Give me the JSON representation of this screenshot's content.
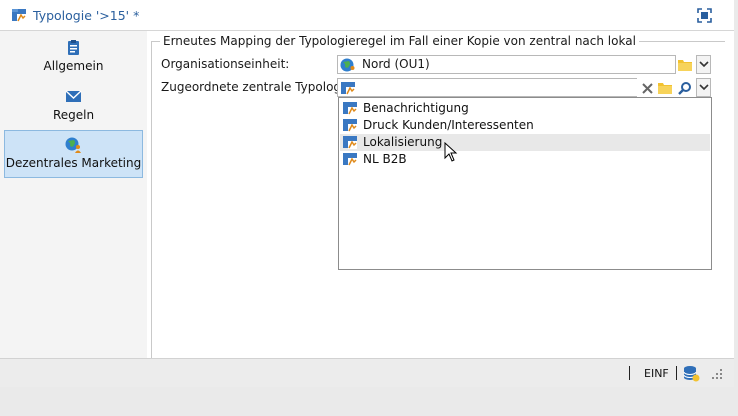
{
  "window": {
    "title": "Typologie '>15' *"
  },
  "sidebar": {
    "items": [
      {
        "label": "Allgemein",
        "icon": "clipboard-icon"
      },
      {
        "label": "Regeln",
        "icon": "envelope-icon"
      },
      {
        "label": "Dezentrales Marketing",
        "icon": "globe-person-icon",
        "active": true
      }
    ]
  },
  "form": {
    "group_title": "Erneutes Mapping der Typologieregel im Fall einer Kopie von zentral nach lokal",
    "org_label": "Organisationseinheit:",
    "org_value": "Nord (OU1)",
    "typology_label": "Zugeordnete zentrale Typologie:",
    "typology_value": ""
  },
  "dropdown": {
    "items": [
      {
        "label": "Benachrichtigung"
      },
      {
        "label": "Druck Kunden/Interessenten"
      },
      {
        "label": "Lokalisierung",
        "hovered": true
      },
      {
        "label": "NL B2B"
      }
    ]
  },
  "statusbar": {
    "mode": "EINF"
  },
  "colors": {
    "accent": "#2a5f9e",
    "sidebar_active": "#cde3f7",
    "folder": "#f2c230"
  }
}
